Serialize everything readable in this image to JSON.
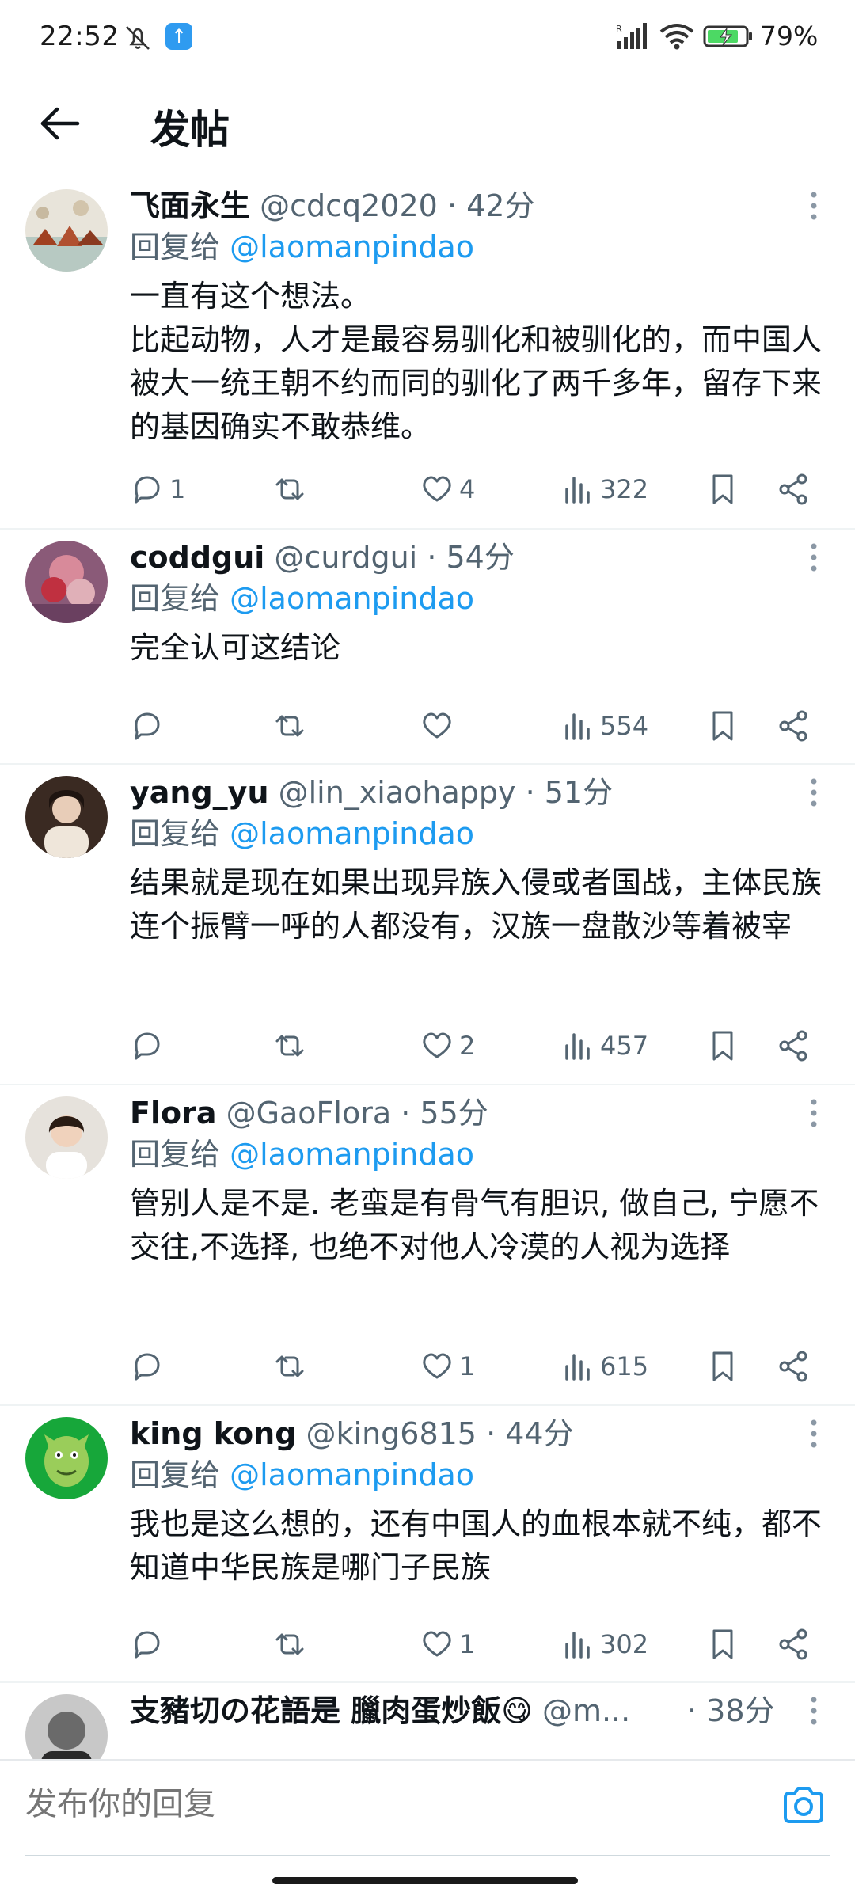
{
  "status_bar": {
    "time": "22:52",
    "battery_percent": "79%",
    "app_badge": "↑",
    "accent": "#2f9bf0"
  },
  "header": {
    "title": "发帖",
    "back_icon": "arrow-left-icon"
  },
  "posts": [
    {
      "name": "飞面永生",
      "handle": "@cdcq2020",
      "time": "· 42分",
      "reply_label": "回复给",
      "reply_mention": "@laomanpindao",
      "text": "一直有这个想法。\n比起动物，人才是最容易驯化和被驯化的，而中国人被大一统王朝不约而同的驯化了两千多年，留存下来的基因确实不敢恭维。",
      "replies": "1",
      "retweets": "",
      "likes": "4",
      "views": "322"
    },
    {
      "name": "coddgui",
      "handle": "@curdgui",
      "time": "· 54分",
      "reply_label": "回复给",
      "reply_mention": "@laomanpindao",
      "text": "完全认可这结论",
      "replies": "",
      "retweets": "",
      "likes": "",
      "views": "554"
    },
    {
      "name": "yang_yu",
      "handle": "@lin_xiaohappy",
      "time": "· 51分",
      "reply_label": "回复给",
      "reply_mention": "@laomanpindao",
      "text": "结果就是现在如果出现异族入侵或者国战，主体民族连个振臂一呼的人都没有，汉族一盘散沙等着被宰",
      "replies": "",
      "retweets": "",
      "likes": "2",
      "views": "457"
    },
    {
      "name": "Flora",
      "handle": "@GaoFlora",
      "time": "· 55分",
      "reply_label": "回复给",
      "reply_mention": "@laomanpindao",
      "text": "管别人是不是. 老蛮是有骨气有胆识, 做自己, 宁愿不交往,不选择, 也绝不对他人冷漠的人视为选择",
      "replies": "",
      "retweets": "",
      "likes": "1",
      "views": "615"
    },
    {
      "name": "king kong",
      "handle": "@king6815",
      "time": "· 44分",
      "reply_label": "回复给",
      "reply_mention": "@laomanpindao",
      "text": "我也是这么想的，还有中国人的血根本就不纯，都不知道中华民族是哪门子民族",
      "replies": "",
      "retweets": "",
      "likes": "1",
      "views": "302"
    },
    {
      "name": "支豬切の花語是 臘肉蛋炒飯😋",
      "handle": "@m...",
      "time": "· 38分",
      "reply_label": "",
      "reply_mention": "",
      "text": "",
      "replies": "",
      "retweets": "",
      "likes": "",
      "views": ""
    }
  ],
  "composer": {
    "placeholder": "发布你的回复",
    "camera_icon": "camera-icon"
  },
  "colors": {
    "text_primary": "#0f1419",
    "text_secondary": "#536471",
    "mention": "#1d9bf0",
    "divider": "#eff3f4"
  }
}
